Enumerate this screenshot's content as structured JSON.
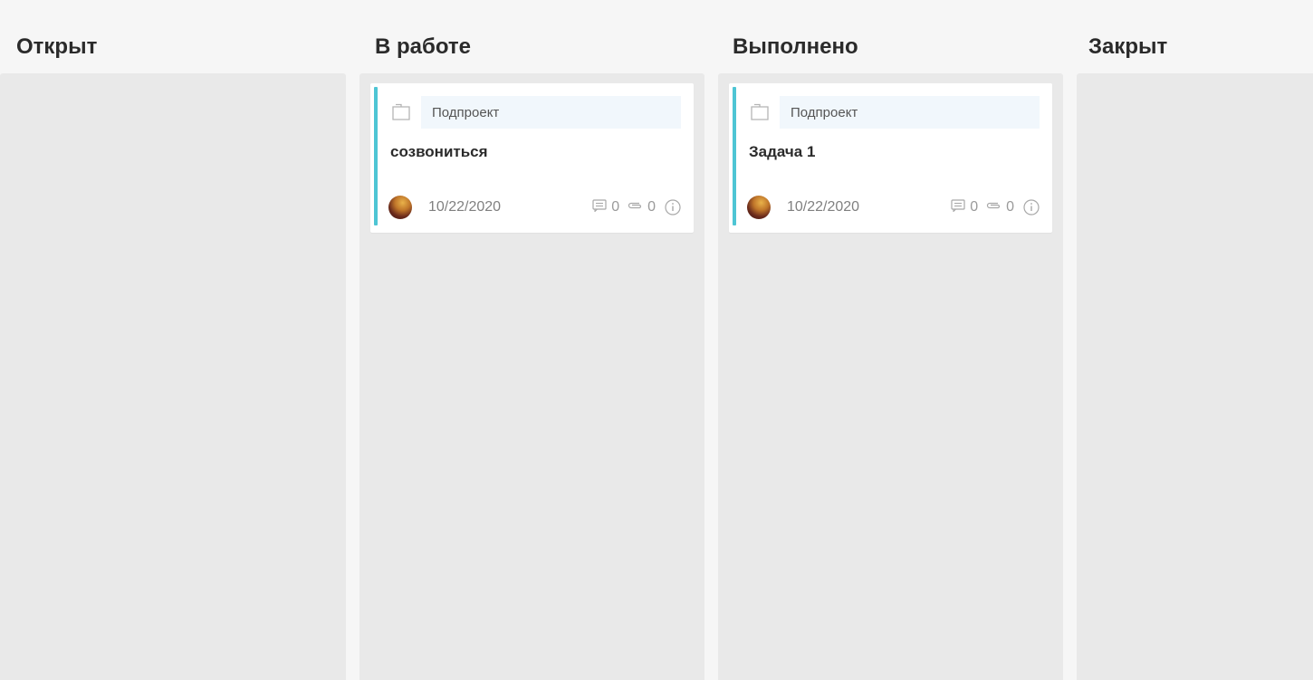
{
  "board": {
    "columns": [
      {
        "title": "Открыт",
        "cards": []
      },
      {
        "title": "В работе",
        "cards": [
          {
            "project": "Подпроект",
            "title": "созвониться",
            "date": "10/22/2020",
            "comments": "0",
            "attachments": "0"
          }
        ]
      },
      {
        "title": "Выполнено",
        "cards": [
          {
            "project": "Подпроект",
            "title": "Задача 1",
            "date": "10/22/2020",
            "comments": "0",
            "attachments": "0"
          }
        ]
      },
      {
        "title": "Закрыт",
        "cards": []
      }
    ]
  },
  "icons": {
    "folder": "folder-icon",
    "comment": "comment-icon",
    "attachment": "paperclip-icon",
    "info": "info-icon"
  },
  "colors": {
    "accent": "#4ec5d4",
    "column_bg": "#e9e9e9",
    "project_tag_bg": "#f1f7fc"
  }
}
